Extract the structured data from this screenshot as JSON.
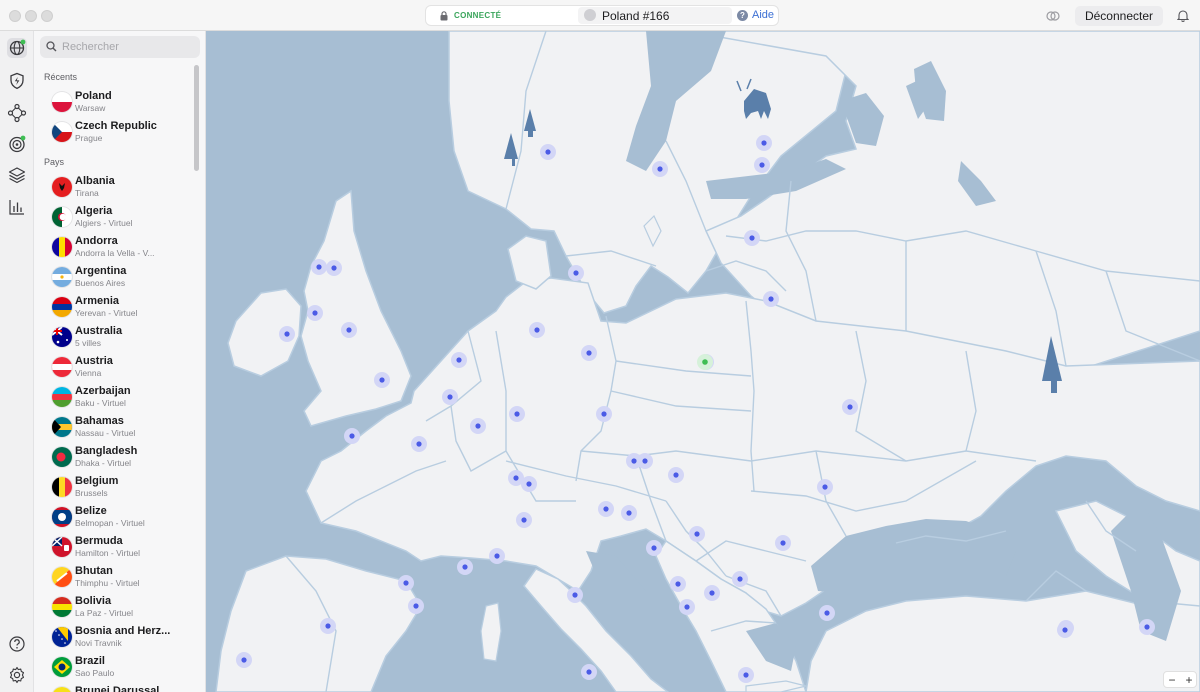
{
  "titlebar": {
    "status": "CONNECTÉ",
    "server": "Poland #166",
    "help_label": "Aide",
    "disconnect_label": "Déconnecter"
  },
  "search": {
    "placeholder": "Rechercher"
  },
  "sidebar": {
    "recent_heading": "Récents",
    "recent": [
      {
        "name": "Poland",
        "sub": "Warsaw",
        "flag": "poland"
      },
      {
        "name": "Czech Republic",
        "sub": "Prague",
        "flag": "czech"
      }
    ],
    "countries_heading": "Pays",
    "countries": [
      {
        "name": "Albania",
        "sub": "Tirana",
        "flag": "albania"
      },
      {
        "name": "Algeria",
        "sub": "Algiers - Virtuel",
        "flag": "algeria"
      },
      {
        "name": "Andorra",
        "sub": "Andorra la Vella - V...",
        "flag": "andorra"
      },
      {
        "name": "Argentina",
        "sub": "Buenos Aires",
        "flag": "argentina"
      },
      {
        "name": "Armenia",
        "sub": "Yerevan - Virtuel",
        "flag": "armenia"
      },
      {
        "name": "Australia",
        "sub": "5 villes",
        "flag": "australia"
      },
      {
        "name": "Austria",
        "sub": "Vienna",
        "flag": "austria"
      },
      {
        "name": "Azerbaijan",
        "sub": "Baku - Virtuel",
        "flag": "azerbaijan"
      },
      {
        "name": "Bahamas",
        "sub": "Nassau - Virtuel",
        "flag": "bahamas"
      },
      {
        "name": "Bangladesh",
        "sub": "Dhaka - Virtuel",
        "flag": "bangladesh"
      },
      {
        "name": "Belgium",
        "sub": "Brussels",
        "flag": "belgium"
      },
      {
        "name": "Belize",
        "sub": "Belmopan - Virtuel",
        "flag": "belize"
      },
      {
        "name": "Bermuda",
        "sub": "Hamilton - Virtuel",
        "flag": "bermuda"
      },
      {
        "name": "Bhutan",
        "sub": "Thimphu - Virtuel",
        "flag": "bhutan"
      },
      {
        "name": "Bolivia",
        "sub": "La Paz - Virtuel",
        "flag": "bolivia"
      },
      {
        "name": "Bosnia and Herz...",
        "sub": "Novi Travnik",
        "flag": "bosnia"
      },
      {
        "name": "Brazil",
        "sub": "Sao Paulo",
        "flag": "brazil"
      },
      {
        "name": "Brunei Darussal...",
        "sub": "",
        "flag": "brunei"
      }
    ]
  },
  "rail_icons": [
    "globe-icon",
    "shield-bolt-icon",
    "meshnet-icon",
    "radar-icon",
    "layers-icon",
    "stats-icon",
    "help-icon",
    "settings-icon"
  ],
  "map": {
    "connected_country": "Poland",
    "colors": {
      "land": "#f1f2f4",
      "sea": "#a7bed3",
      "border": "#b8cde0",
      "marker": "#4b5be6",
      "marker_halo": "#d3d6f6",
      "connected_marker": "#3fbe54"
    }
  },
  "zoom": {
    "minus": "−",
    "plus": "+"
  }
}
